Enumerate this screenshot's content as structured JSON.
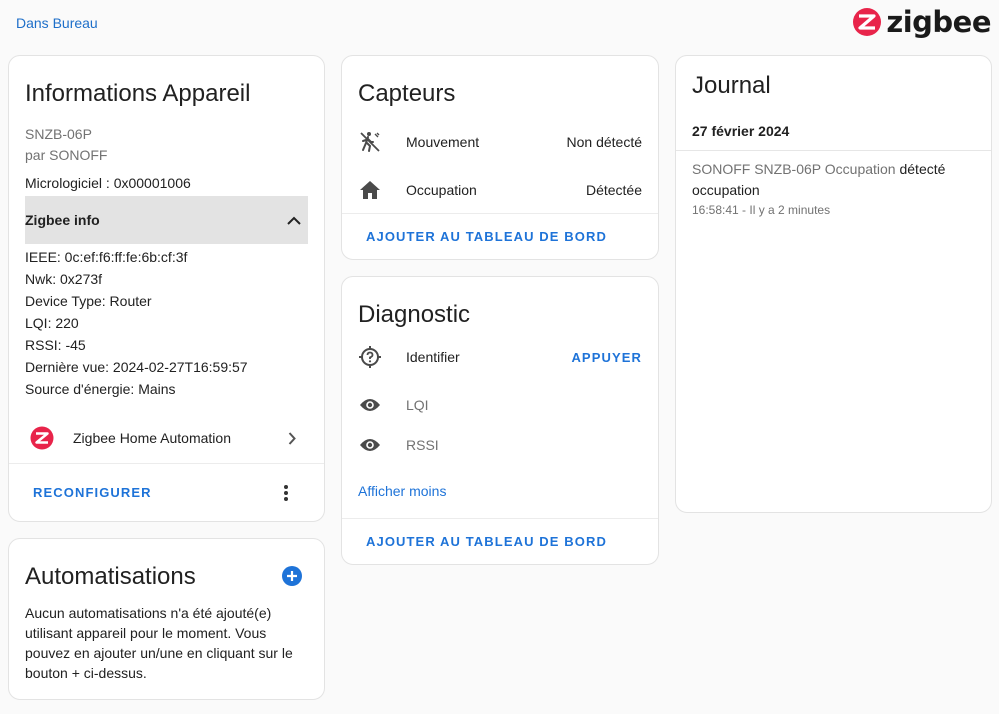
{
  "breadcrumb": {
    "area_link": "Dans Bureau"
  },
  "brand": {
    "logo_text": "zigbee",
    "logo_color": "#e8244a"
  },
  "device_info": {
    "title": "Informations Appareil",
    "model": "SNZB-06P",
    "manufacturer": "par SONOFF",
    "firmware": "Micrologiciel : 0x00001006",
    "zigbee_info": {
      "header": "Zigbee info",
      "lines": [
        "IEEE: 0c:ef:f6:ff:fe:6b:cf:3f",
        "Nwk: 0x273f",
        "Device Type: Router",
        "LQI: 220",
        "RSSI: -45",
        "Dernière vue: 2024-02-27T16:59:57",
        "Source d'énergie: Mains"
      ]
    },
    "integration": "Zigbee Home Automation",
    "reconfigure_button": "RECONFIGURER"
  },
  "automations": {
    "title": "Automatisations",
    "empty_text": "Aucun automatisations n'a été ajouté(e) utilisant appareil pour le moment. Vous pouvez en ajouter un/une en cliquant sur le bouton + ci-dessus."
  },
  "sensors": {
    "title": "Capteurs",
    "rows": [
      {
        "icon": "motion-sensor-off-icon",
        "name": "Mouvement",
        "state": "Non détecté"
      },
      {
        "icon": "home-icon",
        "name": "Occupation",
        "state": "Détectée"
      }
    ],
    "add_to_dashboard": "AJOUTER AU TABLEAU DE BORD"
  },
  "diagnostic": {
    "title": "Diagnostic",
    "identify": {
      "name": "Identifier",
      "action": "APPUYER"
    },
    "rows": [
      {
        "icon": "eye-icon",
        "name": "LQI"
      },
      {
        "icon": "eye-icon",
        "name": "RSSI"
      }
    ],
    "show_less": "Afficher moins",
    "add_to_dashboard": "AJOUTER AU TABLEAU DE BORD"
  },
  "logbook": {
    "title": "Journal",
    "date": "27 février 2024",
    "entry_source": "SONOFF SNZB-06P Occupation",
    "entry_action": " détecté occupation",
    "entry_time": "16:58:41 - Il y a 2 minutes"
  },
  "colors": {
    "accent": "#1e73d8",
    "zigbee_red": "#e8244a",
    "icon_grey": "#4a4a4a"
  }
}
